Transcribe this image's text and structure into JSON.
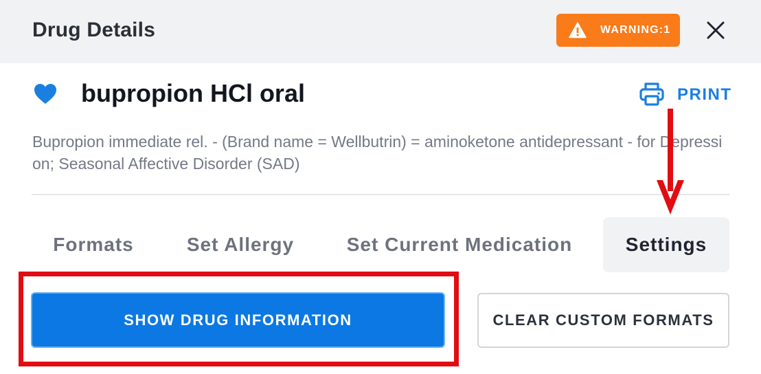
{
  "header": {
    "title": "Drug Details",
    "warning_label": "WARNING:1",
    "warning_color": "#f97b19",
    "close_icon": "close-icon"
  },
  "drug": {
    "name": "bupropion HCl oral",
    "favorite_icon": "heart-icon",
    "favorite_color": "#1a7fe0",
    "description": "Bupropion immediate rel. - (Brand name = Wellbutrin) = aminoketone antidepressant - for Depression; Seasonal Affective Disorder (SAD)"
  },
  "print": {
    "label": "PRINT",
    "icon": "printer-icon",
    "color": "#1a7fe0"
  },
  "tabs": [
    {
      "label": "Formats",
      "active": false
    },
    {
      "label": "Set Allergy",
      "active": false
    },
    {
      "label": "Set Current Medication",
      "active": false
    },
    {
      "label": "Settings",
      "active": true
    }
  ],
  "actions": {
    "show_info_label": "SHOW DRUG INFORMATION",
    "clear_formats_label": "CLEAR CUSTOM FORMATS",
    "primary_color": "#0b78e3"
  },
  "annotations": {
    "highlight_color": "#e10d13"
  }
}
